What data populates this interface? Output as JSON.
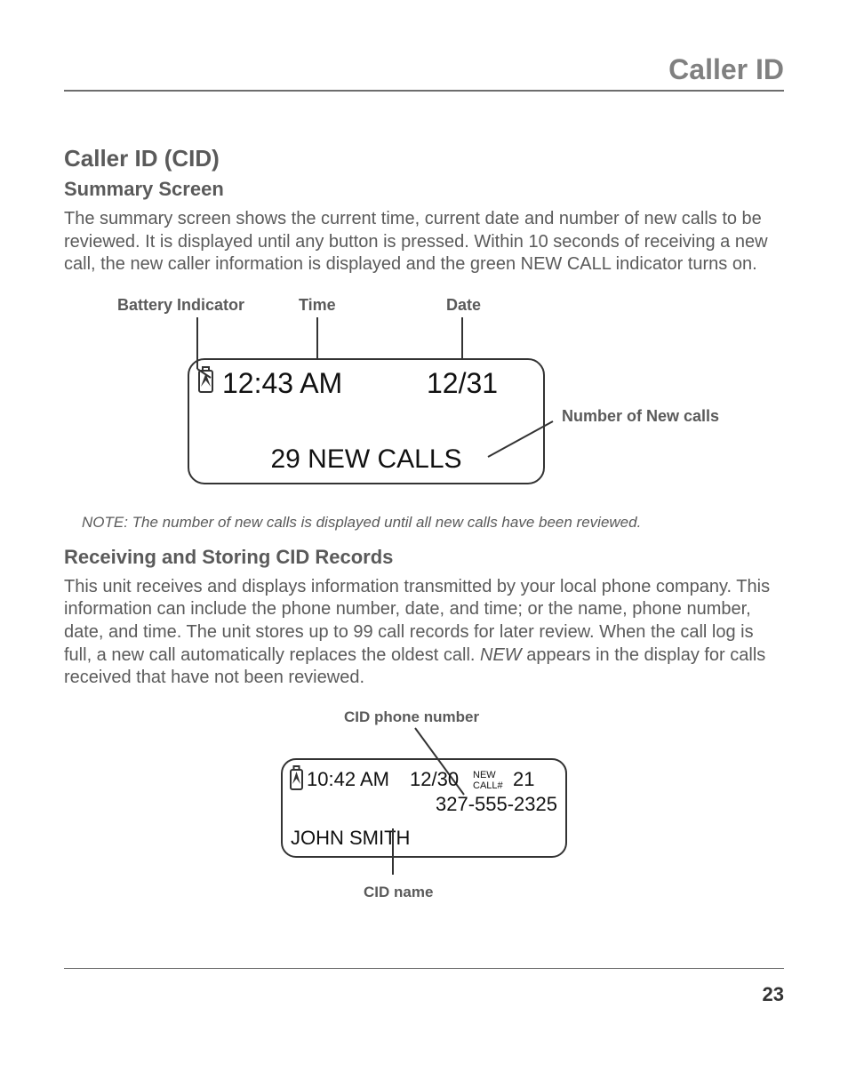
{
  "header": {
    "title": "Caller ID"
  },
  "section1": {
    "h1": "Caller ID (CID)",
    "h2": "Summary Screen",
    "para": "The summary screen shows the current time, current date and number of new calls to be reviewed. It is displayed until any button is pressed. Within 10 seconds of receiving a new call, the new caller information is displayed and the green NEW CALL indicator turns on."
  },
  "diagram1": {
    "labels": {
      "battery": "Battery Indicator",
      "time": "Time",
      "date": "Date",
      "newcalls": "Number of New calls"
    },
    "display": {
      "time": "12:43 AM",
      "date": "12/31",
      "line2": "29 NEW CALLS"
    }
  },
  "note": "NOTE: The number of new calls is displayed until all new calls have been reviewed.",
  "section2": {
    "h2": "Receiving and Storing CID Records",
    "para_a": "This unit receives and displays information transmitted by your local phone company. This information can include the phone number, date, and time; or the name, phone number, date, and time. The unit stores up to 99 call records for later review. When the call log is full, a new call automatically replaces the oldest call. ",
    "para_italic": "NEW",
    "para_b": " appears in the display for calls received that have not been reviewed."
  },
  "diagram2": {
    "labels": {
      "cidnum": "CID phone number",
      "cidname": "CID name"
    },
    "display": {
      "time": "10:42 AM",
      "date": "12/30",
      "new": "NEW",
      "callh": "CALL#",
      "callnum": "21",
      "phone": "327-555-2325",
      "name": "JOHN SMITH"
    }
  },
  "page": "23"
}
